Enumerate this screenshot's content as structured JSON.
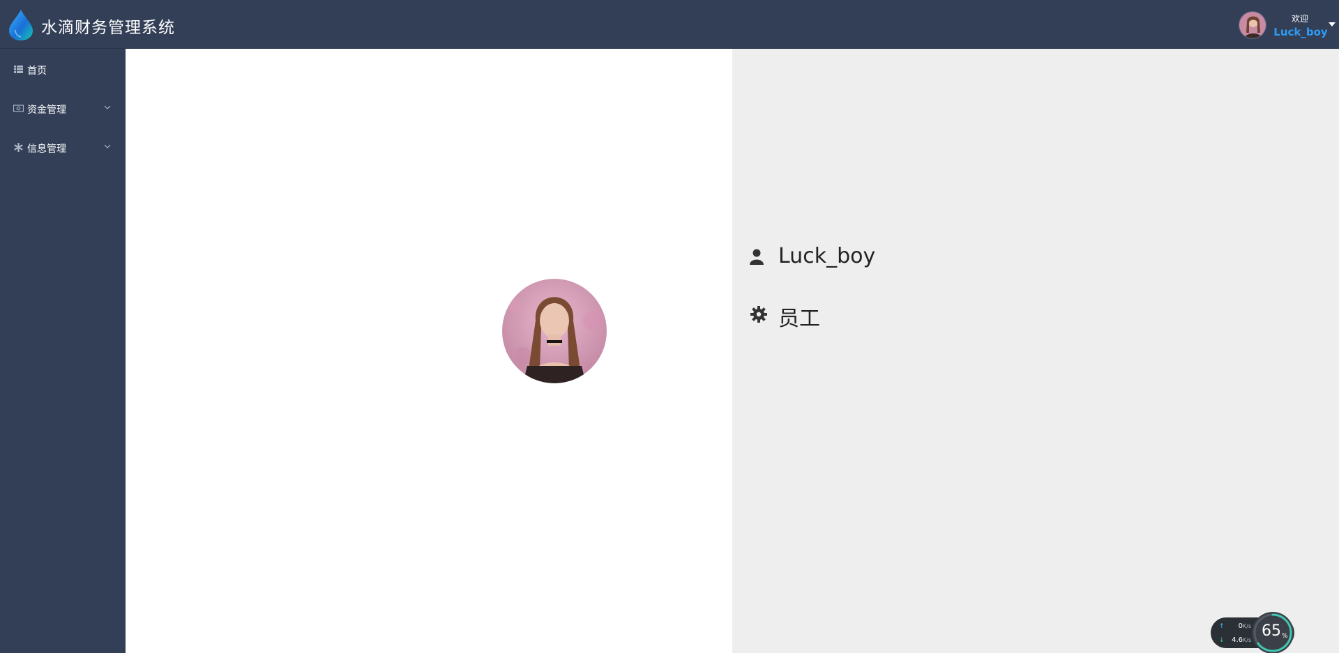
{
  "header": {
    "app_title": "水滴财务管理系统",
    "logo_icon": "water-drop-icon",
    "welcome_label": "欢迎",
    "user_name": "Luck_boy",
    "menu_icon": "caret-down-icon"
  },
  "sidebar": {
    "items": [
      {
        "label": "首页",
        "icon": "list-icon",
        "expandable": false
      },
      {
        "label": "资金管理",
        "icon": "money-icon",
        "expandable": true
      },
      {
        "label": "信息管理",
        "icon": "asterisk-icon",
        "expandable": true
      }
    ]
  },
  "profile": {
    "username": "Luck_boy",
    "role": "员工",
    "username_icon": "user-icon",
    "role_icon": "gear-icon"
  },
  "net_monitor": {
    "upload_value": "0",
    "upload_unit": "K/s",
    "download_value": "4.6",
    "download_unit": "K/s",
    "usage_value": "65",
    "usage_unit": "%",
    "usage_fraction": 0.65
  },
  "colors": {
    "header_bg": "#323f57",
    "sidebar_bg": "#323f57",
    "accent": "#2f9bf2",
    "right_panel_bg": "#eeeeee"
  }
}
